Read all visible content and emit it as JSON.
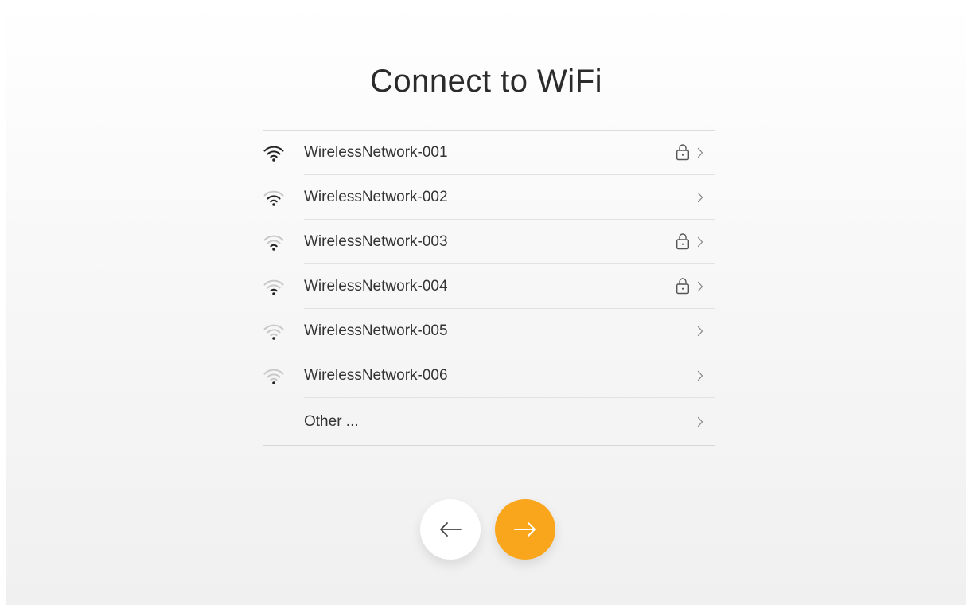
{
  "title": "Connect to WiFi",
  "colors": {
    "accent": "#f9a61c",
    "text": "#333333",
    "signal_strong": "#222222",
    "signal_weak": "#c8c8c8"
  },
  "networks": [
    {
      "name": "WirelessNetwork-001",
      "signal_bars": 3,
      "locked": true,
      "signal_icon": "wifi-full-icon"
    },
    {
      "name": "WirelessNetwork-002",
      "signal_bars": 2,
      "locked": false,
      "signal_icon": "wifi-medium-icon"
    },
    {
      "name": "WirelessNetwork-003",
      "signal_bars": 1,
      "locked": true,
      "signal_icon": "wifi-low-icon"
    },
    {
      "name": "WirelessNetwork-004",
      "signal_bars": 1,
      "locked": true,
      "signal_icon": "wifi-low-icon"
    },
    {
      "name": "WirelessNetwork-005",
      "signal_bars": 0,
      "locked": false,
      "signal_icon": "wifi-weak-icon"
    },
    {
      "name": "WirelessNetwork-006",
      "signal_bars": 0,
      "locked": false,
      "signal_icon": "wifi-weak-icon"
    }
  ],
  "other_label": "Other ...",
  "buttons": {
    "back_icon": "arrow-left-icon",
    "next_icon": "arrow-right-icon"
  }
}
